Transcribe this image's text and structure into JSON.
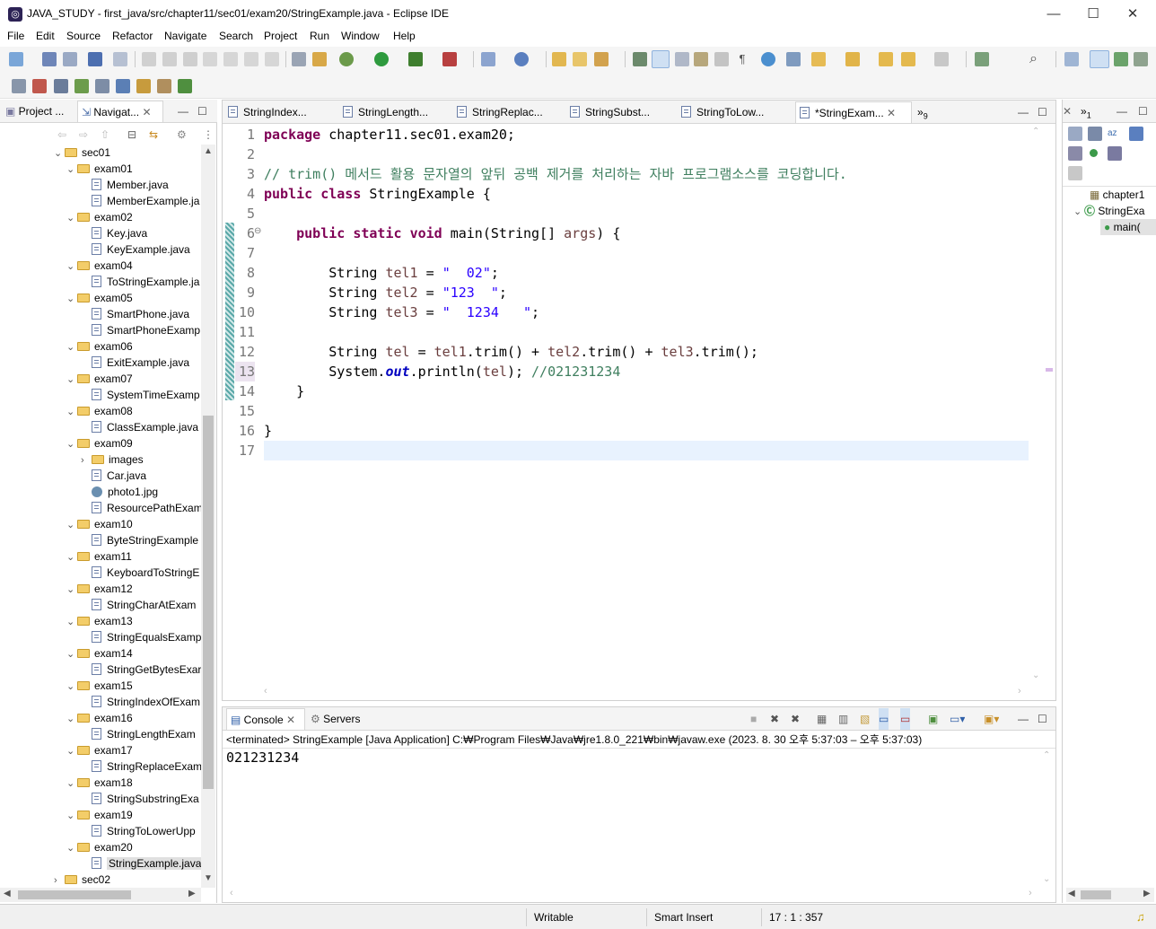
{
  "window": {
    "title": "JAVA_STUDY - first_java/src/chapter11/sec01/exam20/StringExample.java - Eclipse IDE"
  },
  "menu": [
    "File",
    "Edit",
    "Source",
    "Refactor",
    "Navigate",
    "Search",
    "Project",
    "Run",
    "Window",
    "Help"
  ],
  "left_panel": {
    "tabs": [
      "Project ...",
      "Navigat..."
    ],
    "tree": [
      {
        "label": "sec01",
        "kind": "folder",
        "depth": 0,
        "open": true
      },
      {
        "label": "exam01",
        "kind": "folder",
        "depth": 1,
        "open": true
      },
      {
        "label": "Member.java",
        "kind": "file",
        "depth": 2
      },
      {
        "label": "MemberExample.ja",
        "kind": "file",
        "depth": 2
      },
      {
        "label": "exam02",
        "kind": "folder",
        "depth": 1,
        "open": true
      },
      {
        "label": "Key.java",
        "kind": "file",
        "depth": 2
      },
      {
        "label": "KeyExample.java",
        "kind": "file",
        "depth": 2
      },
      {
        "label": "exam04",
        "kind": "folder",
        "depth": 1,
        "open": true
      },
      {
        "label": "ToStringExample.ja",
        "kind": "file",
        "depth": 2
      },
      {
        "label": "exam05",
        "kind": "folder",
        "depth": 1,
        "open": true
      },
      {
        "label": "SmartPhone.java",
        "kind": "file",
        "depth": 2
      },
      {
        "label": "SmartPhoneExamp",
        "kind": "file",
        "depth": 2
      },
      {
        "label": "exam06",
        "kind": "folder",
        "depth": 1,
        "open": true
      },
      {
        "label": "ExitExample.java",
        "kind": "file",
        "depth": 2
      },
      {
        "label": "exam07",
        "kind": "folder",
        "depth": 1,
        "open": true
      },
      {
        "label": "SystemTimeExamp",
        "kind": "file",
        "depth": 2
      },
      {
        "label": "exam08",
        "kind": "folder",
        "depth": 1,
        "open": true
      },
      {
        "label": "ClassExample.java",
        "kind": "file",
        "depth": 2
      },
      {
        "label": "exam09",
        "kind": "folder",
        "depth": 1,
        "open": true
      },
      {
        "label": "images",
        "kind": "folder",
        "depth": 2,
        "open": false
      },
      {
        "label": "Car.java",
        "kind": "file",
        "depth": 2
      },
      {
        "label": "photo1.jpg",
        "kind": "image",
        "depth": 2
      },
      {
        "label": "ResourcePathExam",
        "kind": "file",
        "depth": 2
      },
      {
        "label": "exam10",
        "kind": "folder",
        "depth": 1,
        "open": true
      },
      {
        "label": "ByteStringExample",
        "kind": "file",
        "depth": 2
      },
      {
        "label": "exam11",
        "kind": "folder",
        "depth": 1,
        "open": true
      },
      {
        "label": "KeyboardToStringE",
        "kind": "file",
        "depth": 2
      },
      {
        "label": "exam12",
        "kind": "folder",
        "depth": 1,
        "open": true
      },
      {
        "label": "StringCharAtExam",
        "kind": "file",
        "depth": 2
      },
      {
        "label": "exam13",
        "kind": "folder",
        "depth": 1,
        "open": true
      },
      {
        "label": "StringEqualsExamp",
        "kind": "file",
        "depth": 2
      },
      {
        "label": "exam14",
        "kind": "folder",
        "depth": 1,
        "open": true
      },
      {
        "label": "StringGetBytesExar",
        "kind": "file",
        "depth": 2
      },
      {
        "label": "exam15",
        "kind": "folder",
        "depth": 1,
        "open": true
      },
      {
        "label": "StringIndexOfExam",
        "kind": "file",
        "depth": 2
      },
      {
        "label": "exam16",
        "kind": "folder",
        "depth": 1,
        "open": true
      },
      {
        "label": "StringLengthExam",
        "kind": "file",
        "depth": 2
      },
      {
        "label": "exam17",
        "kind": "folder",
        "depth": 1,
        "open": true
      },
      {
        "label": "StringReplaceExam",
        "kind": "file",
        "depth": 2
      },
      {
        "label": "exam18",
        "kind": "folder",
        "depth": 1,
        "open": true
      },
      {
        "label": "StringSubstringExa",
        "kind": "file",
        "depth": 2
      },
      {
        "label": "exam19",
        "kind": "folder",
        "depth": 1,
        "open": true
      },
      {
        "label": "StringToLowerUpp",
        "kind": "file",
        "depth": 2
      },
      {
        "label": "exam20",
        "kind": "folder",
        "depth": 1,
        "open": true
      },
      {
        "label": "StringExample.java",
        "kind": "file",
        "depth": 2,
        "selected": true
      },
      {
        "label": "sec02",
        "kind": "folder",
        "depth": 0,
        "open": false
      }
    ]
  },
  "editor": {
    "tabs": [
      "StringIndex...",
      "StringLength...",
      "StringReplac...",
      "StringSubst...",
      "StringToLow...",
      "*StringExam..."
    ],
    "active_tab": 5,
    "overflow_label": "9",
    "lines": [
      [
        {
          "t": "package",
          "c": "kw"
        },
        {
          "t": " chapter11.sec01.exam20;",
          "c": ""
        }
      ],
      [],
      [
        {
          "t": "// trim() 메서드 활용 문자열의 앞뒤 공백 제거를 처리하는 자바 프로그램소스를 코딩합니다.",
          "c": "cm"
        }
      ],
      [
        {
          "t": "public",
          "c": "kw"
        },
        {
          "t": " ",
          "c": ""
        },
        {
          "t": "class",
          "c": "kw"
        },
        {
          "t": " StringExample {",
          "c": ""
        }
      ],
      [],
      [
        {
          "t": "    ",
          "c": ""
        },
        {
          "t": "public",
          "c": "kw"
        },
        {
          "t": " ",
          "c": ""
        },
        {
          "t": "static",
          "c": "kw"
        },
        {
          "t": " ",
          "c": ""
        },
        {
          "t": "void",
          "c": "kw"
        },
        {
          "t": " main(String[] ",
          "c": ""
        },
        {
          "t": "args",
          "c": "lv"
        },
        {
          "t": ") {",
          "c": ""
        }
      ],
      [],
      [
        {
          "t": "        String ",
          "c": ""
        },
        {
          "t": "tel1",
          "c": "lv"
        },
        {
          "t": " = ",
          "c": ""
        },
        {
          "t": "\"  02\"",
          "c": "st"
        },
        {
          "t": ";",
          "c": ""
        }
      ],
      [
        {
          "t": "        String ",
          "c": ""
        },
        {
          "t": "tel2",
          "c": "lv"
        },
        {
          "t": " = ",
          "c": ""
        },
        {
          "t": "\"123  \"",
          "c": "st"
        },
        {
          "t": ";",
          "c": ""
        }
      ],
      [
        {
          "t": "        String ",
          "c": ""
        },
        {
          "t": "tel3",
          "c": "lv"
        },
        {
          "t": " = ",
          "c": ""
        },
        {
          "t": "\"  1234   \"",
          "c": "st"
        },
        {
          "t": ";",
          "c": ""
        }
      ],
      [],
      [
        {
          "t": "        String ",
          "c": ""
        },
        {
          "t": "tel",
          "c": "lv"
        },
        {
          "t": " = ",
          "c": ""
        },
        {
          "t": "tel1",
          "c": "lv"
        },
        {
          "t": ".trim() + ",
          "c": ""
        },
        {
          "t": "tel2",
          "c": "lv"
        },
        {
          "t": ".trim() + ",
          "c": ""
        },
        {
          "t": "tel3",
          "c": "lv"
        },
        {
          "t": ".trim();",
          "c": ""
        }
      ],
      [
        {
          "t": "        System.",
          "c": ""
        },
        {
          "t": "out",
          "c": "fd"
        },
        {
          "t": ".println(",
          "c": ""
        },
        {
          "t": "tel",
          "c": "lv"
        },
        {
          "t": "); ",
          "c": ""
        },
        {
          "t": "//021231234",
          "c": "cm"
        }
      ],
      [
        {
          "t": "    }",
          "c": ""
        }
      ],
      [],
      [
        {
          "t": "}",
          "c": ""
        }
      ],
      []
    ]
  },
  "console": {
    "tabs": [
      "Console",
      "Servers"
    ],
    "status": "<terminated> StringExample [Java Application] C:₩Program Files₩Java₩jre1.8.0_221₩bin₩javaw.exe  (2023. 8. 30 오후 5:37:03 – 오후 5:37:03)",
    "output": "021231234"
  },
  "outline": {
    "overflow_label": "1",
    "items": [
      "chapter1",
      "StringExa",
      "main("
    ]
  },
  "statusbar": {
    "writable": "Writable",
    "insert_mode": "Smart Insert",
    "position": "17 : 1 : 357"
  }
}
